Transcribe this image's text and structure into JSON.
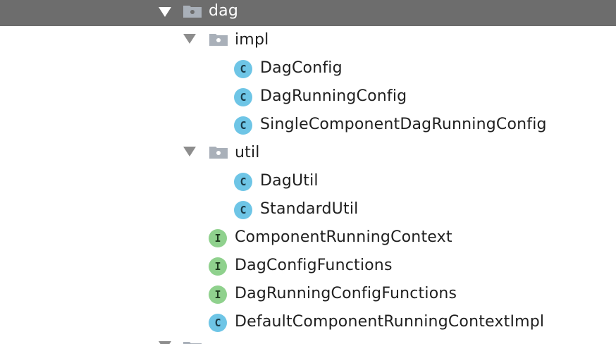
{
  "tree": {
    "root": {
      "label": "dag",
      "type": "package",
      "expanded": true,
      "selected": true
    },
    "impl": {
      "label": "impl",
      "type": "package",
      "expanded": true,
      "children": [
        {
          "label": "DagConfig",
          "type": "class",
          "badge": "C"
        },
        {
          "label": "DagRunningConfig",
          "type": "class",
          "badge": "C"
        },
        {
          "label": "SingleComponentDagRunningConfig",
          "type": "class",
          "badge": "C"
        }
      ]
    },
    "util": {
      "label": "util",
      "type": "package",
      "expanded": true,
      "children": [
        {
          "label": "DagUtil",
          "type": "class",
          "badge": "C"
        },
        {
          "label": "StandardUtil",
          "type": "class",
          "badge": "C"
        }
      ]
    },
    "items": [
      {
        "label": "ComponentRunningContext",
        "type": "interface",
        "badge": "I"
      },
      {
        "label": "DagConfigFunctions",
        "type": "interface",
        "badge": "I"
      },
      {
        "label": "DagRunningConfigFunctions",
        "type": "interface",
        "badge": "I"
      },
      {
        "label": "DefaultComponentRunningContextImpl",
        "type": "class",
        "badge": "C"
      }
    ]
  },
  "colors": {
    "selection": "#6d6d6d",
    "class_badge": "#6ec5e6",
    "interface_badge": "#8fd18d",
    "folder": "#a9b0b9",
    "text": "#1f1f1f"
  },
  "icons": {
    "expand": "triangle-down-icon",
    "package": "package-folder-icon",
    "class": "class-c-icon",
    "interface": "interface-i-icon"
  }
}
